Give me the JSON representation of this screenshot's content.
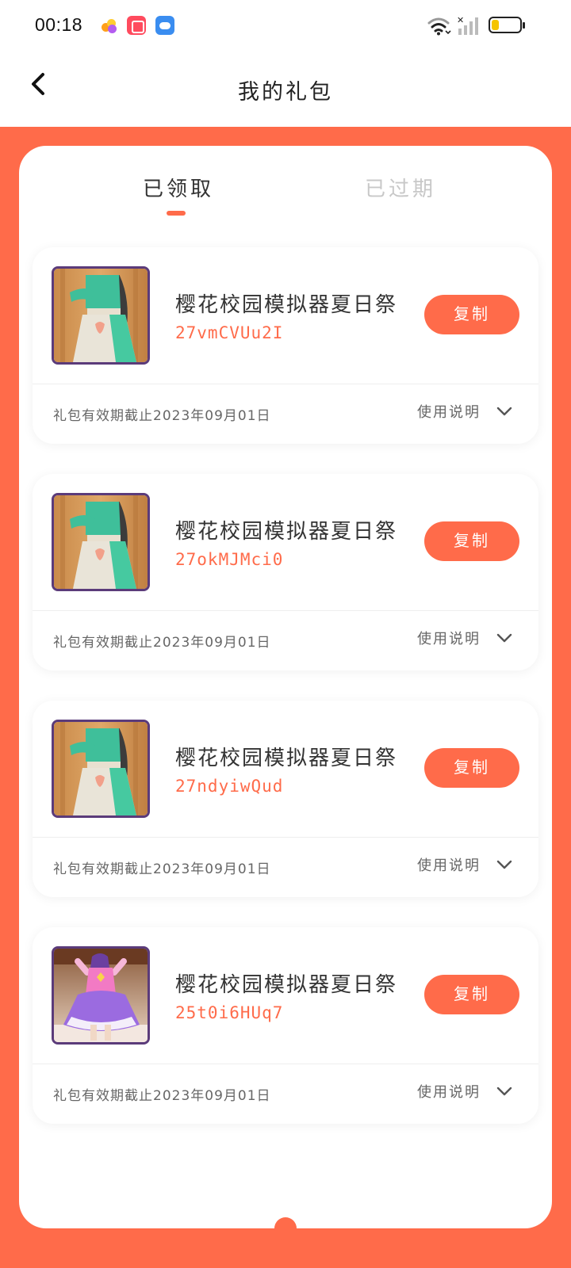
{
  "status_bar": {
    "time": "00:18"
  },
  "header": {
    "title": "我的礼包"
  },
  "tabs": [
    {
      "label": "已领取",
      "active": true
    },
    {
      "label": "已过期",
      "active": false
    }
  ],
  "colors": {
    "accent": "#ff6b4a",
    "inactive_tab": "#c8c8c8"
  },
  "icons": {
    "back": "chevron-left-icon",
    "expand": "chevron-down-icon",
    "wifi": "wifi-icon",
    "signal": "signal-icon",
    "battery": "battery-icon"
  },
  "battery_level": 0.25,
  "gifts": [
    {
      "name": "樱花校园模拟器夏日祭",
      "code": "27vmCVUu2I",
      "expiry": "礼包有效期截止2023年09月01日",
      "copy_label": "复制",
      "usage_label": "使用说明",
      "thumb": "green-dress"
    },
    {
      "name": "樱花校园模拟器夏日祭",
      "code": "27okMJMci0",
      "expiry": "礼包有效期截止2023年09月01日",
      "copy_label": "复制",
      "usage_label": "使用说明",
      "thumb": "green-dress"
    },
    {
      "name": "樱花校园模拟器夏日祭",
      "code": "27ndyiwQud",
      "expiry": "礼包有效期截止2023年09月01日",
      "copy_label": "复制",
      "usage_label": "使用说明",
      "thumb": "green-dress"
    },
    {
      "name": "樱花校园模拟器夏日祭",
      "code": "25t0i6HUq7",
      "expiry": "礼包有效期截止2023年09月01日",
      "copy_label": "复制",
      "usage_label": "使用说明",
      "thumb": "purple-dress"
    }
  ]
}
